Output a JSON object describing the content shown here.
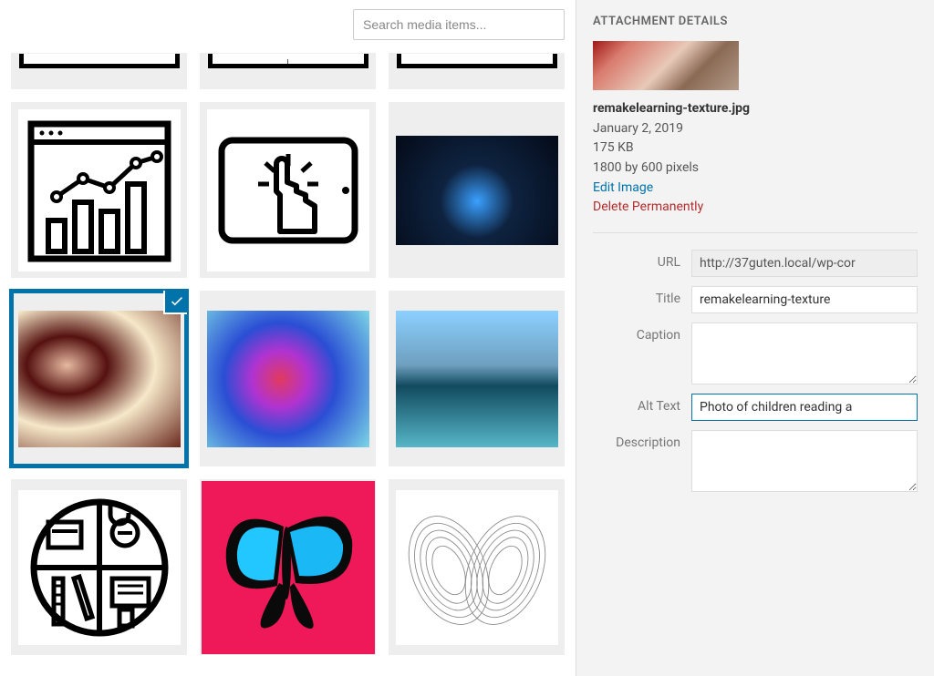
{
  "search": {
    "placeholder": "Search media items..."
  },
  "details": {
    "panel_title": "ATTACHMENT DETAILS",
    "filename": "remakelearning-texture.jpg",
    "date": "January 2, 2019",
    "filesize": "175 KB",
    "dimensions": "1800 by 600 pixels",
    "edit_image": "Edit Image",
    "delete_permanently": "Delete Permanently",
    "labels": {
      "url": "URL",
      "title": "Title",
      "caption": "Caption",
      "alt_text": "Alt Text",
      "description": "Description"
    },
    "values": {
      "url": "http://37guten.local/wp-cor",
      "title": "remakelearning-texture",
      "caption": "",
      "alt_text": "Photo of children reading a",
      "description": ""
    }
  },
  "grid": {
    "partial_row_count": 3,
    "items": [
      {
        "kind": "icon",
        "icon": "bar-chart",
        "selected": false
      },
      {
        "kind": "icon",
        "icon": "tablet-touch",
        "selected": false
      },
      {
        "kind": "photo",
        "variant": "butterfly-dark",
        "selected": false
      },
      {
        "kind": "photo",
        "variant": "kids",
        "selected": true
      },
      {
        "kind": "photo",
        "variant": "ink",
        "selected": false
      },
      {
        "kind": "photo",
        "variant": "glass",
        "selected": false
      },
      {
        "kind": "icon",
        "icon": "design-circle",
        "selected": false
      },
      {
        "kind": "photo",
        "variant": "butterfly-pink",
        "selected": false
      },
      {
        "kind": "icon",
        "icon": "attractor",
        "selected": false
      }
    ]
  }
}
